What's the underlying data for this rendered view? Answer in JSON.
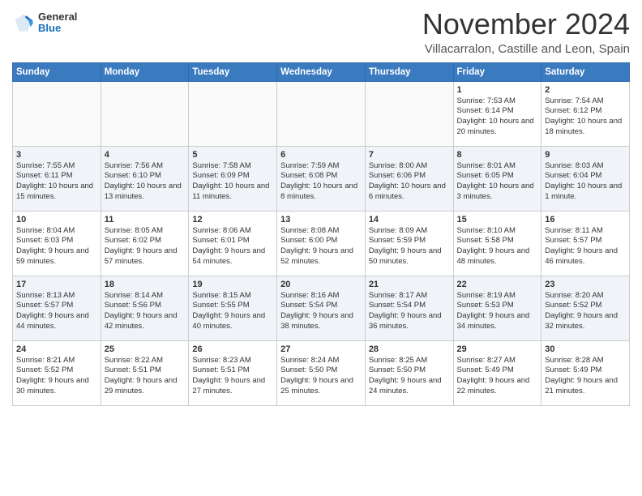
{
  "header": {
    "logo_general": "General",
    "logo_blue": "Blue",
    "month": "November 2024",
    "location": "Villacarralon, Castille and Leon, Spain"
  },
  "days_of_week": [
    "Sunday",
    "Monday",
    "Tuesday",
    "Wednesday",
    "Thursday",
    "Friday",
    "Saturday"
  ],
  "weeks": [
    [
      {
        "day": "",
        "sunrise": "",
        "sunset": "",
        "daylight": ""
      },
      {
        "day": "",
        "sunrise": "",
        "sunset": "",
        "daylight": ""
      },
      {
        "day": "",
        "sunrise": "",
        "sunset": "",
        "daylight": ""
      },
      {
        "day": "",
        "sunrise": "",
        "sunset": "",
        "daylight": ""
      },
      {
        "day": "",
        "sunrise": "",
        "sunset": "",
        "daylight": ""
      },
      {
        "day": "1",
        "sunrise": "Sunrise: 7:53 AM",
        "sunset": "Sunset: 6:14 PM",
        "daylight": "Daylight: 10 hours and 20 minutes."
      },
      {
        "day": "2",
        "sunrise": "Sunrise: 7:54 AM",
        "sunset": "Sunset: 6:12 PM",
        "daylight": "Daylight: 10 hours and 18 minutes."
      }
    ],
    [
      {
        "day": "3",
        "sunrise": "Sunrise: 7:55 AM",
        "sunset": "Sunset: 6:11 PM",
        "daylight": "Daylight: 10 hours and 15 minutes."
      },
      {
        "day": "4",
        "sunrise": "Sunrise: 7:56 AM",
        "sunset": "Sunset: 6:10 PM",
        "daylight": "Daylight: 10 hours and 13 minutes."
      },
      {
        "day": "5",
        "sunrise": "Sunrise: 7:58 AM",
        "sunset": "Sunset: 6:09 PM",
        "daylight": "Daylight: 10 hours and 11 minutes."
      },
      {
        "day": "6",
        "sunrise": "Sunrise: 7:59 AM",
        "sunset": "Sunset: 6:08 PM",
        "daylight": "Daylight: 10 hours and 8 minutes."
      },
      {
        "day": "7",
        "sunrise": "Sunrise: 8:00 AM",
        "sunset": "Sunset: 6:06 PM",
        "daylight": "Daylight: 10 hours and 6 minutes."
      },
      {
        "day": "8",
        "sunrise": "Sunrise: 8:01 AM",
        "sunset": "Sunset: 6:05 PM",
        "daylight": "Daylight: 10 hours and 3 minutes."
      },
      {
        "day": "9",
        "sunrise": "Sunrise: 8:03 AM",
        "sunset": "Sunset: 6:04 PM",
        "daylight": "Daylight: 10 hours and 1 minute."
      }
    ],
    [
      {
        "day": "10",
        "sunrise": "Sunrise: 8:04 AM",
        "sunset": "Sunset: 6:03 PM",
        "daylight": "Daylight: 9 hours and 59 minutes."
      },
      {
        "day": "11",
        "sunrise": "Sunrise: 8:05 AM",
        "sunset": "Sunset: 6:02 PM",
        "daylight": "Daylight: 9 hours and 57 minutes."
      },
      {
        "day": "12",
        "sunrise": "Sunrise: 8:06 AM",
        "sunset": "Sunset: 6:01 PM",
        "daylight": "Daylight: 9 hours and 54 minutes."
      },
      {
        "day": "13",
        "sunrise": "Sunrise: 8:08 AM",
        "sunset": "Sunset: 6:00 PM",
        "daylight": "Daylight: 9 hours and 52 minutes."
      },
      {
        "day": "14",
        "sunrise": "Sunrise: 8:09 AM",
        "sunset": "Sunset: 5:59 PM",
        "daylight": "Daylight: 9 hours and 50 minutes."
      },
      {
        "day": "15",
        "sunrise": "Sunrise: 8:10 AM",
        "sunset": "Sunset: 5:58 PM",
        "daylight": "Daylight: 9 hours and 48 minutes."
      },
      {
        "day": "16",
        "sunrise": "Sunrise: 8:11 AM",
        "sunset": "Sunset: 5:57 PM",
        "daylight": "Daylight: 9 hours and 46 minutes."
      }
    ],
    [
      {
        "day": "17",
        "sunrise": "Sunrise: 8:13 AM",
        "sunset": "Sunset: 5:57 PM",
        "daylight": "Daylight: 9 hours and 44 minutes."
      },
      {
        "day": "18",
        "sunrise": "Sunrise: 8:14 AM",
        "sunset": "Sunset: 5:56 PM",
        "daylight": "Daylight: 9 hours and 42 minutes."
      },
      {
        "day": "19",
        "sunrise": "Sunrise: 8:15 AM",
        "sunset": "Sunset: 5:55 PM",
        "daylight": "Daylight: 9 hours and 40 minutes."
      },
      {
        "day": "20",
        "sunrise": "Sunrise: 8:16 AM",
        "sunset": "Sunset: 5:54 PM",
        "daylight": "Daylight: 9 hours and 38 minutes."
      },
      {
        "day": "21",
        "sunrise": "Sunrise: 8:17 AM",
        "sunset": "Sunset: 5:54 PM",
        "daylight": "Daylight: 9 hours and 36 minutes."
      },
      {
        "day": "22",
        "sunrise": "Sunrise: 8:19 AM",
        "sunset": "Sunset: 5:53 PM",
        "daylight": "Daylight: 9 hours and 34 minutes."
      },
      {
        "day": "23",
        "sunrise": "Sunrise: 8:20 AM",
        "sunset": "Sunset: 5:52 PM",
        "daylight": "Daylight: 9 hours and 32 minutes."
      }
    ],
    [
      {
        "day": "24",
        "sunrise": "Sunrise: 8:21 AM",
        "sunset": "Sunset: 5:52 PM",
        "daylight": "Daylight: 9 hours and 30 minutes."
      },
      {
        "day": "25",
        "sunrise": "Sunrise: 8:22 AM",
        "sunset": "Sunset: 5:51 PM",
        "daylight": "Daylight: 9 hours and 29 minutes."
      },
      {
        "day": "26",
        "sunrise": "Sunrise: 8:23 AM",
        "sunset": "Sunset: 5:51 PM",
        "daylight": "Daylight: 9 hours and 27 minutes."
      },
      {
        "day": "27",
        "sunrise": "Sunrise: 8:24 AM",
        "sunset": "Sunset: 5:50 PM",
        "daylight": "Daylight: 9 hours and 25 minutes."
      },
      {
        "day": "28",
        "sunrise": "Sunrise: 8:25 AM",
        "sunset": "Sunset: 5:50 PM",
        "daylight": "Daylight: 9 hours and 24 minutes."
      },
      {
        "day": "29",
        "sunrise": "Sunrise: 8:27 AM",
        "sunset": "Sunset: 5:49 PM",
        "daylight": "Daylight: 9 hours and 22 minutes."
      },
      {
        "day": "30",
        "sunrise": "Sunrise: 8:28 AM",
        "sunset": "Sunset: 5:49 PM",
        "daylight": "Daylight: 9 hours and 21 minutes."
      }
    ]
  ]
}
